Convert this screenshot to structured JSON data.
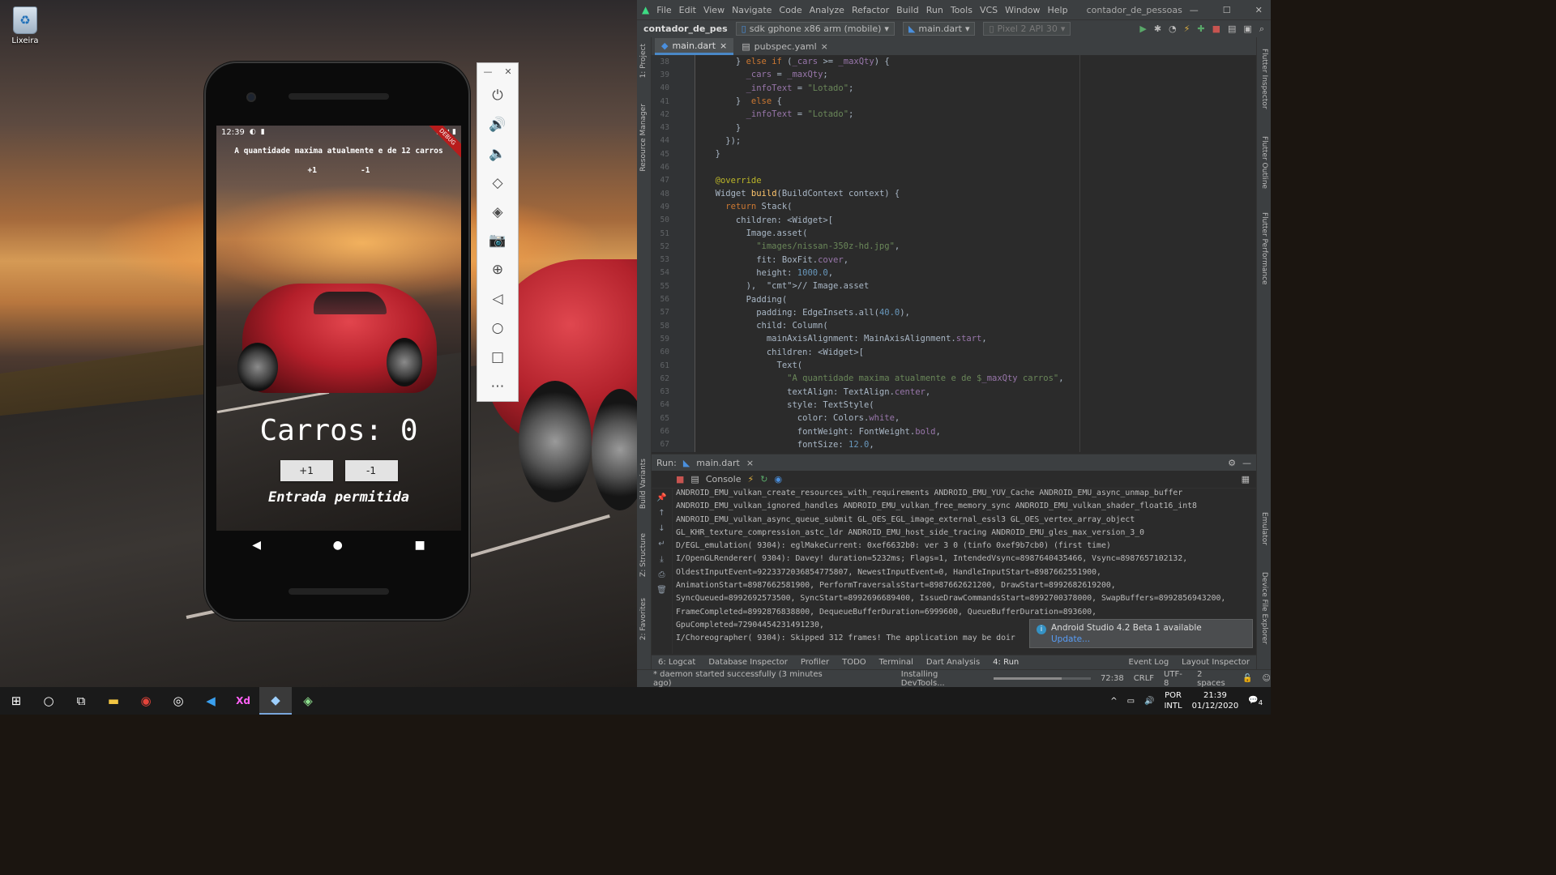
{
  "desktop": {
    "recycle_label": "Lixeira"
  },
  "phone": {
    "status_time": "12:39",
    "debug_banner": "DEBUG",
    "info_text": "A quantidade maxima atualmente e de 12 carros",
    "small_plus": "+1",
    "small_minus": "-1",
    "counter": "Carros: 0",
    "btn_plus": "+1",
    "btn_minus": "-1",
    "status": "Entrada permitida",
    "nav": {
      "back": "◀",
      "home": "●",
      "recents": "■"
    }
  },
  "emulator_tools": [
    "power-icon",
    "volume-up-icon",
    "volume-down-icon",
    "rotate-left-icon",
    "rotate-right-icon",
    "camera-icon",
    "zoom-icon",
    "back-icon",
    "home-icon",
    "overview-icon",
    "more-icon"
  ],
  "ide": {
    "menu": [
      "File",
      "Edit",
      "View",
      "Navigate",
      "Code",
      "Analyze",
      "Refactor",
      "Build",
      "Run",
      "Tools",
      "VCS",
      "Window",
      "Help"
    ],
    "window_title": "contador_de_pessoas",
    "project": "contador_de_pes",
    "device": "sdk gphone x86 arm (mobile)",
    "run_config": "main.dart",
    "avd": "Pixel 2 API 30",
    "tabs": [
      "main.dart",
      "pubspec.yaml"
    ],
    "left_panels": [
      "1: Project",
      "Resource Manager",
      "Build Variants",
      "Z: Structure",
      "2: Favorites"
    ],
    "right_panels": [
      "Flutter Inspector",
      "Flutter Outline",
      "Flutter Performance",
      "Emulator",
      "Device File Explorer"
    ],
    "code_lines": [
      {
        "n": "38",
        "t": "      } else if (_cars >= _maxQty) {"
      },
      {
        "n": "39",
        "t": "        _cars = _maxQty;"
      },
      {
        "n": "40",
        "t": "        _infoText = \"Lotado\";"
      },
      {
        "n": "41",
        "t": "      }  else {"
      },
      {
        "n": "42",
        "t": "        _infoText = \"Lotado\";"
      },
      {
        "n": "43",
        "t": "      }"
      },
      {
        "n": "44",
        "t": "    });"
      },
      {
        "n": "45",
        "t": "  }"
      },
      {
        "n": "46",
        "t": ""
      },
      {
        "n": "47",
        "t": "  @override"
      },
      {
        "n": "48",
        "t": "  Widget build(BuildContext context) {"
      },
      {
        "n": "49",
        "t": "    return Stack("
      },
      {
        "n": "50",
        "t": "      children: <Widget>["
      },
      {
        "n": "51",
        "t": "        Image.asset("
      },
      {
        "n": "52",
        "t": "          \"images/nissan-350z-hd.jpg\","
      },
      {
        "n": "53",
        "t": "          fit: BoxFit.cover,"
      },
      {
        "n": "54",
        "t": "          height: 1000.0,"
      },
      {
        "n": "55",
        "t": "        ),  // Image.asset"
      },
      {
        "n": "56",
        "t": "        Padding("
      },
      {
        "n": "57",
        "t": "          padding: EdgeInsets.all(40.0),"
      },
      {
        "n": "58",
        "t": "          child: Column("
      },
      {
        "n": "59",
        "t": "            mainAxisAlignment: MainAxisAlignment.start,"
      },
      {
        "n": "60",
        "t": "            children: <Widget>["
      },
      {
        "n": "61",
        "t": "              Text("
      },
      {
        "n": "62",
        "t": "                \"A quantidade maxima atualmente e de $_maxQty carros\","
      },
      {
        "n": "63",
        "t": "                textAlign: TextAlign.center,"
      },
      {
        "n": "64",
        "t": "                style: TextStyle("
      },
      {
        "n": "65",
        "t": "                  color: Colors.white,"
      },
      {
        "n": "66",
        "t": "                  fontWeight: FontWeight.bold,"
      },
      {
        "n": "67",
        "t": "                  fontSize: 12.0,"
      }
    ],
    "run_label": "Run:",
    "run_tab": "main.dart",
    "console_tab": "Console",
    "console_lines": [
      "  ANDROID_EMU_vulkan_create_resources_with_requirements ANDROID_EMU_YUV_Cache ANDROID_EMU_async_unmap_buffer",
      "  ANDROID_EMU_vulkan_ignored_handles ANDROID_EMU_vulkan_free_memory_sync ANDROID_EMU_vulkan_shader_float16_int8",
      "  ANDROID_EMU_vulkan_async_queue_submit GL_OES_EGL_image_external_essl3 GL_OES_vertex_array_object",
      "  GL_KHR_texture_compression_astc_ldr ANDROID_EMU_host_side_tracing ANDROID_EMU_gles_max_version_3_0",
      "D/EGL_emulation( 9304): eglMakeCurrent: 0xef6632b0: ver 3 0 (tinfo 0xef9b7cb0) (first time)",
      "I/OpenGLRenderer( 9304): Davey! duration=5232ms; Flags=1, IntendedVsync=8987640435466, Vsync=8987657102132,",
      "  OldestInputEvent=9223372036854775807, NewestInputEvent=0, HandleInputStart=8987662551900,",
      "  AnimationStart=8987662581900, PerformTraversalsStart=8987662621200, DrawStart=8992682619200,",
      "  SyncQueued=8992692573500, SyncStart=8992696689400, IssueDrawCommandsStart=8992700378000, SwapBuffers=8992856943200,",
      "  FrameCompleted=8992876838800, DequeueBufferDuration=6999600, QueueBufferDuration=893600,",
      "  GpuCompleted=72904454231491230,",
      "I/Choreographer( 9304): Skipped 312 frames!  The application may be doir"
    ],
    "notification": {
      "title": "Android Studio 4.2 Beta 1 available",
      "action": "Update..."
    },
    "bottom_tabs": [
      "6: Logcat",
      "Database Inspector",
      "Profiler",
      "TODO",
      "Terminal",
      "Dart Analysis",
      "4: Run",
      "Event Log",
      "Layout Inspector"
    ],
    "status": {
      "message": "* daemon started successfully (3 minutes ago)",
      "task": "Installing DevTools...",
      "position": "72:38",
      "line_sep": "CRLF",
      "encoding": "UTF-8",
      "indent": "2 spaces"
    }
  },
  "taskbar": {
    "apps": [
      "start-icon",
      "search-icon",
      "task-view-icon",
      "file-explorer-icon",
      "chrome-icon",
      "github-desktop-icon",
      "vscode-icon",
      "adobe-xd-icon",
      "android-studio-icon",
      "emulator-icon"
    ],
    "lang_top": "POR",
    "lang_bottom": "INTL",
    "time": "21:39",
    "date": "01/12/2020",
    "notifications": "4"
  }
}
